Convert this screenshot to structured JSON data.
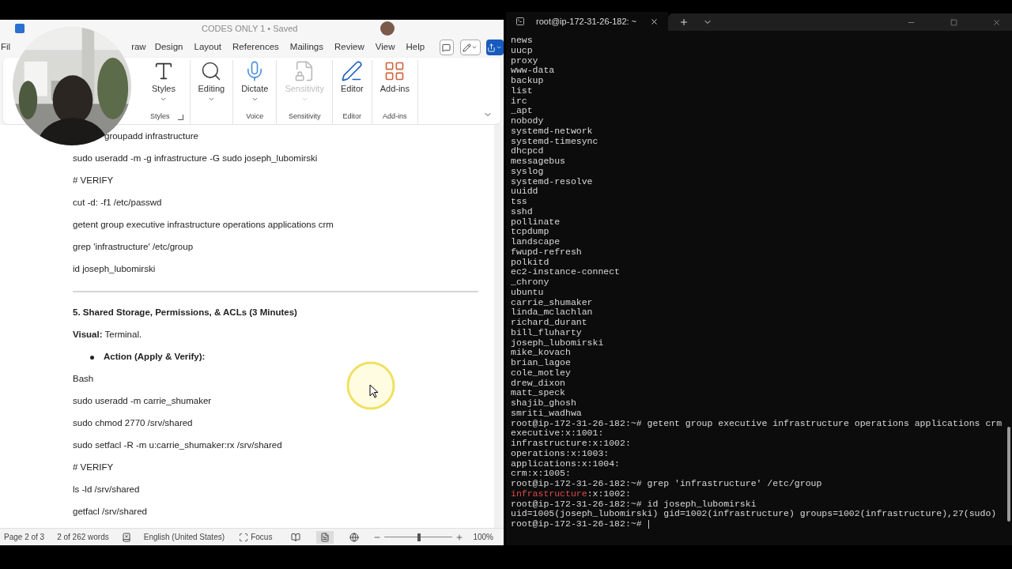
{
  "word": {
    "title": "CODES ONLY 1 • Saved",
    "tabs": [
      {
        "label": "Fil",
        "selected": false
      },
      {
        "label": "raw",
        "selected": false
      },
      {
        "label": "Design",
        "selected": false
      },
      {
        "label": "Layout",
        "selected": false
      },
      {
        "label": "References",
        "selected": false
      },
      {
        "label": "Mailings",
        "selected": false
      },
      {
        "label": "Review",
        "selected": false
      },
      {
        "label": "View",
        "selected": false
      },
      {
        "label": "Help",
        "selected": false
      }
    ],
    "ribbon": [
      {
        "label": "Styles",
        "launcher": true,
        "buttons": [
          {
            "label": "Styles",
            "dropdown": true,
            "disabled": false
          }
        ]
      },
      {
        "buttons": [
          {
            "label": "Editing",
            "dropdown": true,
            "disabled": false
          }
        ]
      },
      {
        "label": "Voice",
        "buttons": [
          {
            "label": "Dictate",
            "dropdown": true,
            "disabled": false
          }
        ]
      },
      {
        "label": "Sensitivity",
        "buttons": [
          {
            "label": "Sensitivity",
            "dropdown": true,
            "disabled": true
          }
        ]
      },
      {
        "label": "Editor",
        "buttons": [
          {
            "label": "Editor",
            "dropdown": false,
            "disabled": false
          }
        ]
      },
      {
        "label": "Add-ins",
        "buttons": [
          {
            "label": "Add-ins",
            "dropdown": false,
            "disabled": false
          }
        ]
      }
    ],
    "document": [
      {
        "kind": "partial",
        "text": "groupadd infrastructure"
      },
      {
        "kind": "code",
        "text": "sudo useradd -m -g infrastructure -G sudo joseph_lubomirski"
      },
      {
        "kind": "code",
        "text": "# VERIFY"
      },
      {
        "kind": "code",
        "text": "cut -d: -f1 /etc/passwd"
      },
      {
        "kind": "code",
        "text": "getent group executive infrastructure operations applications crm"
      },
      {
        "kind": "code",
        "text": "grep 'infrastructure' /etc/group"
      },
      {
        "kind": "code",
        "text": "id joseph_lubomirski"
      },
      {
        "kind": "rule"
      },
      {
        "kind": "heading",
        "text": "5. Shared Storage, Permissions, & ACLs (3 Minutes)"
      },
      {
        "kind": "label",
        "label": "Visual:",
        "text": "Terminal."
      },
      {
        "kind": "bullet",
        "text": "Action (Apply & Verify):"
      },
      {
        "kind": "code",
        "text": "Bash"
      },
      {
        "kind": "code",
        "text": "sudo useradd -m carrie_shumaker"
      },
      {
        "kind": "code",
        "text": "sudo chmod 2770 /srv/shared"
      },
      {
        "kind": "code",
        "text": "sudo setfacl -R -m u:carrie_shumaker:rx /srv/shared"
      },
      {
        "kind": "code",
        "text": "# VERIFY"
      },
      {
        "kind": "code",
        "text": "ls -ld /srv/shared"
      },
      {
        "kind": "code",
        "text": "getfacl /srv/shared"
      }
    ],
    "status": {
      "page": "Page 2 of 3",
      "words": "2 of 262 words",
      "language": "English (United States)",
      "focus": "Focus",
      "zoom": {
        "level": 0.51
      },
      "zoom_text": "100%"
    }
  },
  "terminal": {
    "tab_title": "root@ip-172-31-26-182: ~",
    "lines": [
      {
        "text": "news"
      },
      {
        "text": "uucp"
      },
      {
        "text": "proxy"
      },
      {
        "text": "www-data"
      },
      {
        "text": "backup"
      },
      {
        "text": "list"
      },
      {
        "text": "irc"
      },
      {
        "text": "_apt"
      },
      {
        "text": "nobody"
      },
      {
        "text": "systemd-network"
      },
      {
        "text": "systemd-timesync"
      },
      {
        "text": "dhcpcd"
      },
      {
        "text": "messagebus"
      },
      {
        "text": "syslog"
      },
      {
        "text": "systemd-resolve"
      },
      {
        "text": "uuidd"
      },
      {
        "text": "tss"
      },
      {
        "text": "sshd"
      },
      {
        "text": "pollinate"
      },
      {
        "text": "tcpdump"
      },
      {
        "text": "landscape"
      },
      {
        "text": "fwupd-refresh"
      },
      {
        "text": "polkitd"
      },
      {
        "text": "ec2-instance-connect"
      },
      {
        "text": "_chrony"
      },
      {
        "text": "ubuntu"
      },
      {
        "text": "carrie_shumaker"
      },
      {
        "text": "linda_mclachlan"
      },
      {
        "text": "richard_durant"
      },
      {
        "text": "bill_fluharty"
      },
      {
        "text": "joseph_lubomirski"
      },
      {
        "text": "mike_kovach"
      },
      {
        "text": "brian_lagoe"
      },
      {
        "text": "cole_motley"
      },
      {
        "text": "drew_dixon"
      },
      {
        "text": "matt_speck"
      },
      {
        "text": "shajib_ghosh"
      },
      {
        "text": "smriti_wadhwa"
      },
      {
        "text": "root@ip-172-31-26-182:~# getent group executive infrastructure operations applications crm"
      },
      {
        "text": "executive:x:1001:"
      },
      {
        "text": "infrastructure:x:1002:"
      },
      {
        "text": "operations:x:1003:"
      },
      {
        "text": "applications:x:1004:"
      },
      {
        "text": "crm:x:1005:"
      },
      {
        "text": "root@ip-172-31-26-182:~# grep 'infrastructure' /etc/group"
      },
      {
        "match": "infrastructure",
        "text": ":x:1002:"
      },
      {
        "text": "root@ip-172-31-26-182:~# id joseph_lubomirski"
      },
      {
        "text": "uid=1005(joseph_lubomirski) gid=1002(infrastructure) groups=1002(infrastructure),27(sudo)"
      },
      {
        "text": "root@ip-172-31-26-182:~# ",
        "cursor": true
      }
    ]
  }
}
